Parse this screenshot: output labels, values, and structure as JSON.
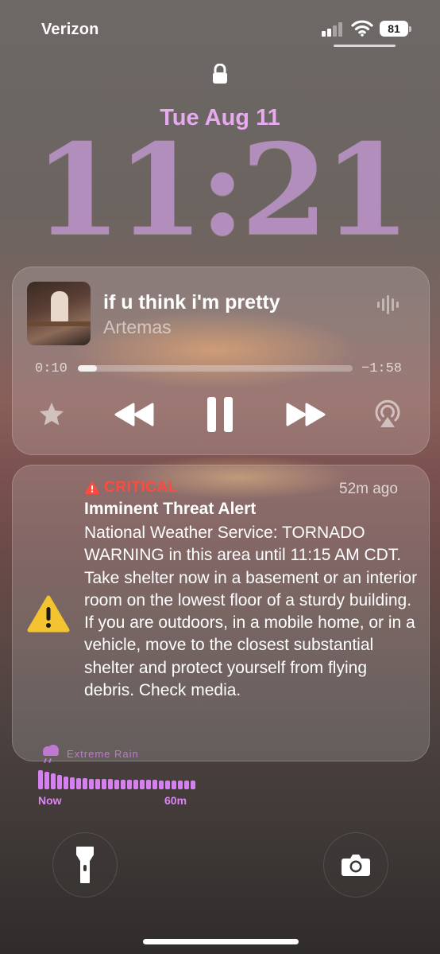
{
  "status_bar": {
    "carrier": "Verizon",
    "battery": "81",
    "signal_bars": 2
  },
  "lockscreen": {
    "date": "Tue Aug 11",
    "time": "11:21",
    "lock_icon": "lock-icon"
  },
  "now_playing": {
    "title": "if u think i'm pretty",
    "artist": "Artemas",
    "elapsed": "0:10",
    "remaining": "−1:58",
    "progress": 0.07,
    "controls": [
      "star-icon",
      "rewind-icon",
      "pause-icon",
      "fast-forward-icon",
      "airplay-icon"
    ]
  },
  "alert": {
    "severity": "CRITICAL",
    "time_ago": "52m ago",
    "title": "Imminent Threat Alert",
    "body": "National Weather Service: TORNADO WARNING in this area until 11:15 AM CDT. Take shelter now in a basement or an interior room on the lowest floor of a sturdy building. If you are outdoors, in a mobile home, or in a vehicle, move to the closest substantial shelter and protect yourself from flying debris. Check media.",
    "colors": {
      "critical": "#ff4a3d",
      "warning_icon": "#f4c430"
    }
  },
  "weather_widget": {
    "label": "Extreme Rain",
    "start_label": "Now",
    "end_label": "60m",
    "intensity": [
      1.0,
      0.9,
      0.82,
      0.74,
      0.68,
      0.64,
      0.6,
      0.58,
      0.56,
      0.55,
      0.54,
      0.53,
      0.52,
      0.51,
      0.5,
      0.5,
      0.49,
      0.48,
      0.48,
      0.47,
      0.47,
      0.46,
      0.46,
      0.45,
      0.45
    ],
    "color": "#d67ff0"
  },
  "bottom_actions": {
    "left": "flashlight-icon",
    "right": "camera-icon"
  }
}
